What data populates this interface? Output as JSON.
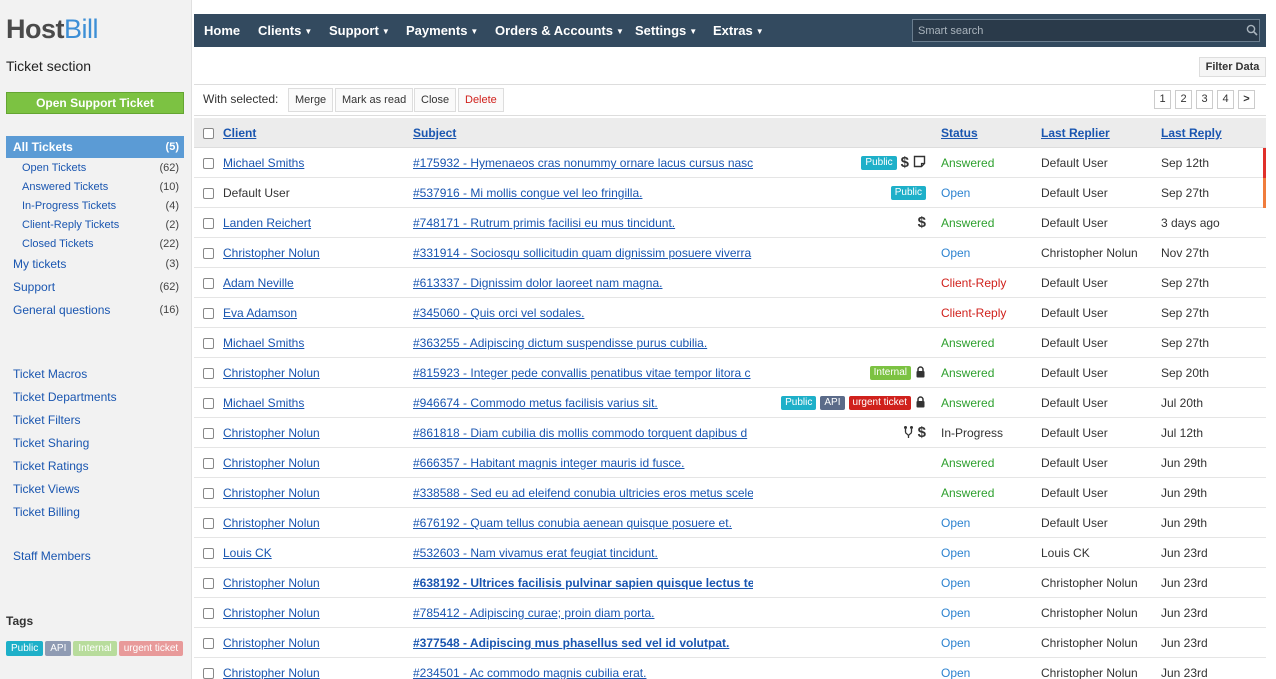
{
  "app": {
    "logo_host": "Host",
    "logo_bill": "Bill",
    "section_title": "Ticket section"
  },
  "sidebar": {
    "open_ticket_label": "Open Support Ticket",
    "nav": [
      {
        "label": "All Tickets",
        "count": "(5)",
        "active": true
      },
      {
        "label": "Open Tickets",
        "count": "(62)",
        "sub": true
      },
      {
        "label": "Answered Tickets",
        "count": "(10)",
        "sub": true
      },
      {
        "label": "In-Progress Tickets",
        "count": "(4)",
        "sub": true
      },
      {
        "label": "Client-Reply Tickets",
        "count": "(2)",
        "sub": true
      },
      {
        "label": "Closed Tickets",
        "count": "(22)",
        "sub": true
      },
      {
        "label": "My tickets",
        "count": "(3)"
      },
      {
        "label": "Support",
        "count": "(62)"
      },
      {
        "label": "General questions",
        "count": "(16)"
      }
    ],
    "tools": [
      "Ticket Macros",
      "Ticket Departments",
      "Ticket Filters",
      "Ticket Sharing",
      "Ticket Ratings",
      "Ticket Views",
      "Ticket Billing"
    ],
    "staff_label": "Staff Members",
    "tags_title": "Tags",
    "tags": [
      {
        "label": "Public",
        "color": "#1eb0c9"
      },
      {
        "label": "API",
        "color": "#8f9bb3"
      },
      {
        "label": "Internal",
        "color": "#b8dc9c"
      },
      {
        "label": "urgent ticket",
        "color": "#e89a9a"
      }
    ]
  },
  "topnav": {
    "menus": [
      {
        "label": "Home",
        "caret": false
      },
      {
        "label": "Clients",
        "caret": true
      },
      {
        "label": "Support",
        "caret": true
      },
      {
        "label": "Payments",
        "caret": true
      },
      {
        "label": "Orders & Accounts",
        "caret": true
      },
      {
        "label": "Settings",
        "caret": true
      },
      {
        "label": "Extras",
        "caret": true
      }
    ],
    "search_placeholder": "Smart search"
  },
  "filter_label": "Filter Data",
  "actions": {
    "with_selected": "With selected:",
    "merge": "Merge",
    "mark_read": "Mark as read",
    "close": "Close",
    "delete": "Delete",
    "pages": [
      "1",
      "2",
      "3",
      "4",
      ">"
    ]
  },
  "table": {
    "headers": {
      "client": "Client",
      "subject": "Subject",
      "status": "Status",
      "last_replier": "Last Replier",
      "last_reply": "Last Reply"
    },
    "rows": [
      {
        "client": "Michael Smiths",
        "client_link": true,
        "subject": "#175932 - Hymenaeos cras nonummy ornare lacus cursus nasc",
        "badges": [
          "Public"
        ],
        "icons": [
          "$",
          "note"
        ],
        "status": "Answered",
        "replier": "Default User",
        "reply": "Sep 12th",
        "marker": "#e0302a"
      },
      {
        "client": "Default User",
        "client_link": false,
        "subject": "#537916 - Mi mollis congue vel leo fringilla.",
        "badges": [
          "Public"
        ],
        "icons": [],
        "status": "Open",
        "replier": "Default User",
        "reply": "Sep 27th",
        "marker": "#f07c3c"
      },
      {
        "client": "Landen Reichert",
        "client_link": true,
        "subject": "#748171 - Rutrum primis facilisi eu mus tincidunt.",
        "badges": [],
        "icons": [
          "$"
        ],
        "status": "Answered",
        "replier": "Default User",
        "reply": "3 days ago"
      },
      {
        "client": "Christopher Nolun",
        "client_link": true,
        "subject": "#331914 - Sociosqu sollicitudin quam dignissim posuere viverra",
        "badges": [],
        "icons": [],
        "status": "Open",
        "replier": "Christopher Nolun",
        "reply": "Nov 27th"
      },
      {
        "client": "Adam Neville",
        "client_link": true,
        "subject": "#613337 - Dignissim dolor laoreet nam magna.",
        "badges": [],
        "icons": [],
        "status": "Client-Reply",
        "replier": "Default User",
        "reply": "Sep 27th"
      },
      {
        "client": "Eva Adamson",
        "client_link": true,
        "subject": "#345060 - Quis orci vel sodales.",
        "badges": [],
        "icons": [],
        "status": "Client-Reply",
        "replier": "Default User",
        "reply": "Sep 27th"
      },
      {
        "client": "Michael Smiths",
        "client_link": true,
        "subject": "#363255 - Adipiscing dictum suspendisse purus cubilia.",
        "badges": [],
        "icons": [],
        "status": "Answered",
        "replier": "Default User",
        "reply": "Sep 27th"
      },
      {
        "client": "Christopher Nolun",
        "client_link": true,
        "subject": "#815923 - Integer pede convallis penatibus vitae tempor litora c",
        "badges": [
          "Internal"
        ],
        "icons": [
          "lock"
        ],
        "status": "Answered",
        "replier": "Default User",
        "reply": "Sep 20th"
      },
      {
        "client": "Michael Smiths",
        "client_link": true,
        "subject": "#946674 - Commodo metus facilisis varius sit.",
        "badges": [
          "Public",
          "API",
          "urgent ticket"
        ],
        "icons": [
          "lock"
        ],
        "status": "Answered",
        "replier": "Default User",
        "reply": "Jul 20th"
      },
      {
        "client": "Christopher Nolun",
        "client_link": true,
        "subject": "#861818 - Diam cubilia dis mollis commodo torquent dapibus d",
        "badges": [],
        "icons": [
          "fork",
          "$"
        ],
        "status": "In-Progress",
        "replier": "Default User",
        "reply": "Jul 12th"
      },
      {
        "client": "Christopher Nolun",
        "client_link": true,
        "subject": "#666357 - Habitant magnis integer mauris id fusce.",
        "badges": [],
        "icons": [],
        "status": "Answered",
        "replier": "Default User",
        "reply": "Jun 29th"
      },
      {
        "client": "Christopher Nolun",
        "client_link": true,
        "subject": "#338588 - Sed eu ad eleifend conubia ultricies eros metus scele",
        "badges": [],
        "icons": [],
        "status": "Answered",
        "replier": "Default User",
        "reply": "Jun 29th"
      },
      {
        "client": "Christopher Nolun",
        "client_link": true,
        "subject": "#676192 - Quam tellus conubia aenean quisque posuere et.",
        "badges": [],
        "icons": [],
        "status": "Open",
        "replier": "Default User",
        "reply": "Jun 29th"
      },
      {
        "client": "Louis CK",
        "client_link": true,
        "subject": "#532603 - Nam vivamus erat feugiat tincidunt.",
        "badges": [],
        "icons": [],
        "status": "Open",
        "replier": "Louis CK",
        "reply": "Jun 23rd"
      },
      {
        "client": "Christopher Nolun",
        "client_link": true,
        "subject": "#638192 - Ultrices facilisis pulvinar sapien quisque lectus te",
        "bold": true,
        "badges": [],
        "icons": [],
        "status": "Open",
        "replier": "Christopher Nolun",
        "reply": "Jun 23rd"
      },
      {
        "client": "Christopher Nolun",
        "client_link": true,
        "subject": "#785412 - Adipiscing curae; proin diam porta.",
        "badges": [],
        "icons": [],
        "status": "Open",
        "replier": "Christopher Nolun",
        "reply": "Jun 23rd"
      },
      {
        "client": "Christopher Nolun",
        "client_link": true,
        "subject": "#377548 - Adipiscing mus phasellus sed vel id volutpat.",
        "bold": true,
        "badges": [],
        "icons": [],
        "status": "Open",
        "replier": "Christopher Nolun",
        "reply": "Jun 23rd"
      },
      {
        "client": "Christopher Nolun",
        "client_link": true,
        "subject": "#234501 - Ac commodo magnis cubilia erat.",
        "badges": [],
        "icons": [],
        "status": "Open",
        "replier": "Christopher Nolun",
        "reply": "Jun 23rd"
      }
    ]
  }
}
